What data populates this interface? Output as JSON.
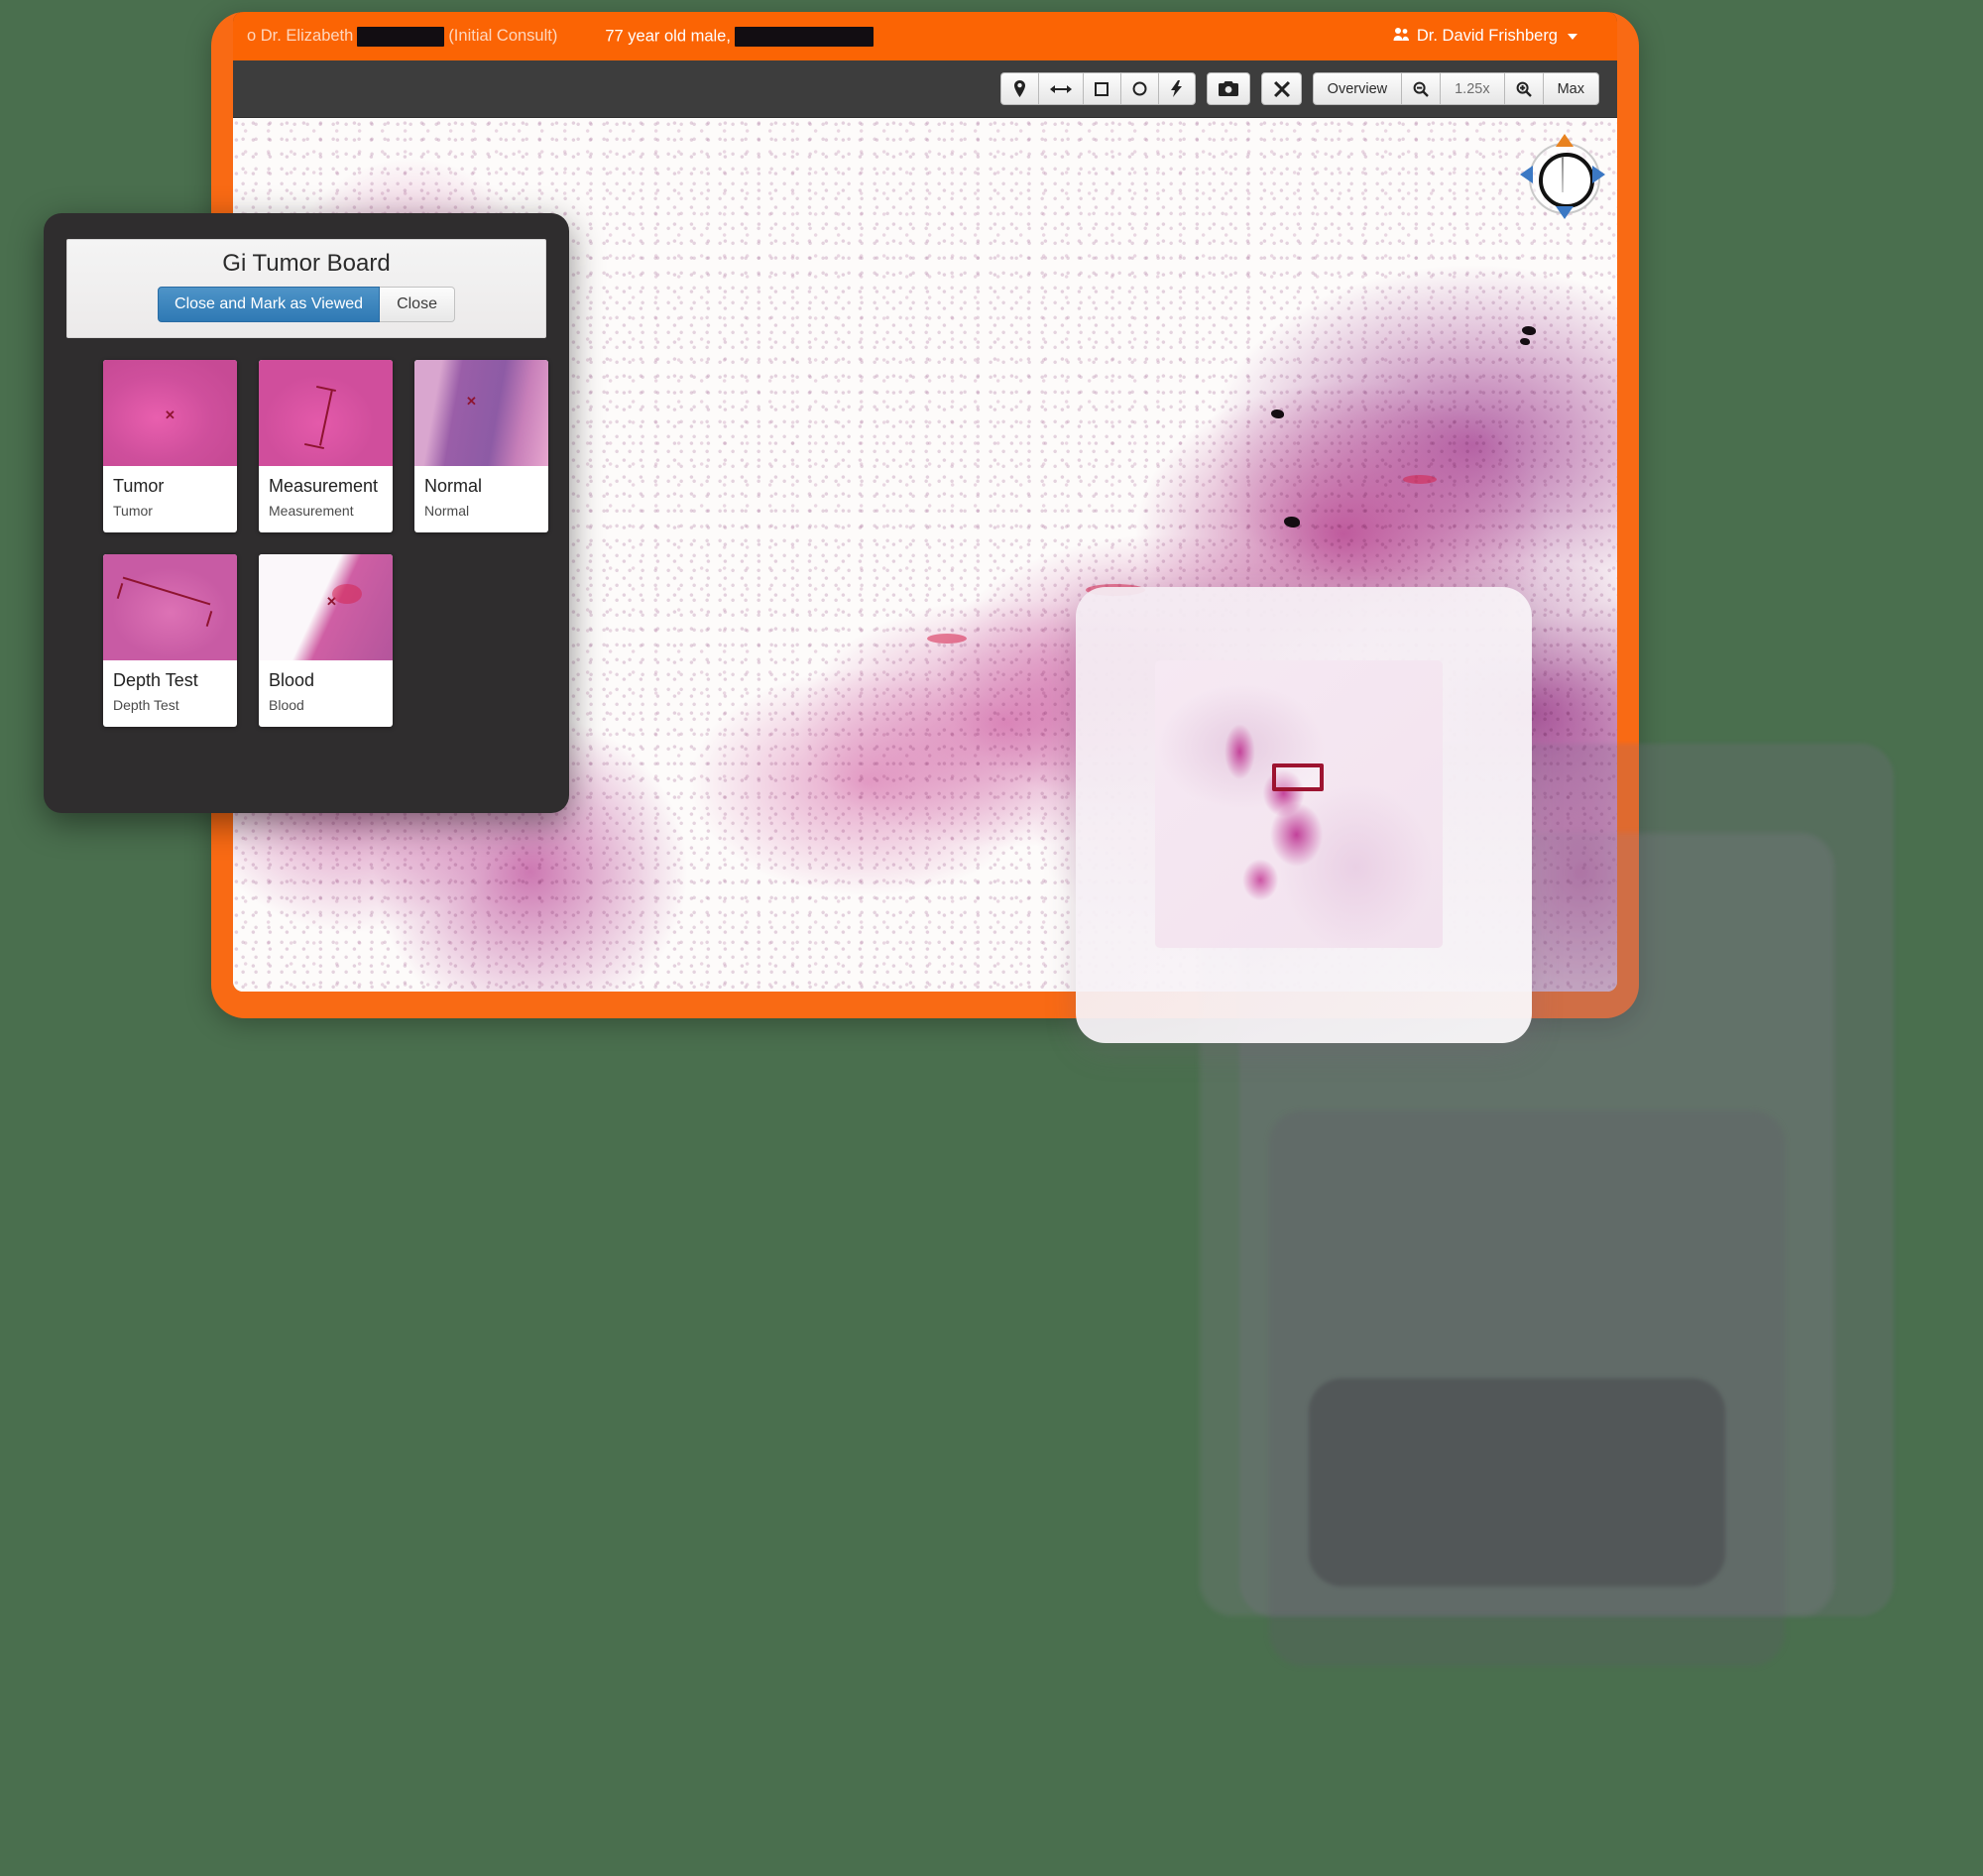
{
  "app": {
    "background_color": "#4a6f4e",
    "frame_color": "#f96a14",
    "header_color": "#fb6404",
    "accent_blue": "#2f79b4"
  },
  "header": {
    "referrer_prefix": "o Dr. Elizabeth",
    "redacted_name": "",
    "consult_type": "(Initial Consult)",
    "patient_summary": "77 year old male,",
    "patient_redacted": "",
    "user_name": "Dr. David Frishberg",
    "user_icon": "user-group-icon",
    "caret_icon": "caret-down-icon"
  },
  "toolbar": {
    "annotation_tools": [
      {
        "name": "pin-tool",
        "glyph": "⚇"
      },
      {
        "name": "ruler-tool",
        "glyph": "⟷"
      },
      {
        "name": "rectangle-tool",
        "glyph": "□"
      },
      {
        "name": "ellipse-tool",
        "glyph": "○"
      },
      {
        "name": "freehand-tool",
        "glyph": "⚡"
      }
    ],
    "camera_label": "📷",
    "fullscreen_label": "✕",
    "overview_label": "Overview",
    "zoom_out_label": "−",
    "zoom_level": "1.25x",
    "zoom_in_label": "+",
    "max_label": "Max"
  },
  "navigator": {
    "name": "compass-navigator",
    "up_color": "#e8821f",
    "arrow_color": "#3b78c4"
  },
  "dialog": {
    "title": "Gi Tumor Board",
    "primary_button": "Close and Mark as Viewed",
    "secondary_button": "Close",
    "cards": [
      {
        "title": "Tumor",
        "subtitle": "Tumor",
        "thumb_class": "th-tumor",
        "annotation": "x-mark"
      },
      {
        "title": "Measurement",
        "subtitle": "Measurement",
        "thumb_class": "th-meas",
        "annotation": "length-line"
      },
      {
        "title": "Normal",
        "subtitle": "Normal",
        "thumb_class": "th-normal",
        "annotation": "x-mark"
      },
      {
        "title": "Depth Test",
        "subtitle": "Depth Test",
        "thumb_class": "th-depth",
        "annotation": "length-line-diagonal"
      },
      {
        "title": "Blood",
        "subtitle": "Blood",
        "thumb_class": "th-blood",
        "annotation": "x-mark"
      }
    ]
  },
  "overview_panel": {
    "name": "slide-overview-panel",
    "viewport_rect_color": "#9d1330"
  }
}
